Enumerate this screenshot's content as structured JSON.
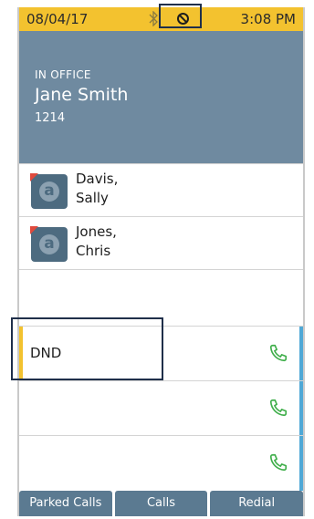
{
  "status_bar": {
    "date": "08/04/17",
    "time": "3:08 PM",
    "icons": [
      "bluetooth-icon",
      "do-not-disturb-icon"
    ],
    "background": "#f3c22f"
  },
  "header": {
    "presence": "IN OFFICE",
    "name": "Jane Smith",
    "extension": "1214",
    "background": "#6f8aa0"
  },
  "contacts": [
    {
      "name_line1": "Davis,",
      "name_line2": "Sally",
      "avatar_letter": "a"
    },
    {
      "name_line1": "Jones,",
      "name_line2": "Chris",
      "avatar_letter": "a"
    }
  ],
  "line_keys": [
    {
      "label": "DND",
      "icon": "phone-icon"
    },
    {
      "label": "",
      "icon": "phone-icon"
    },
    {
      "label": "",
      "icon": "phone-icon"
    }
  ],
  "softkeys": [
    {
      "label": "Parked Calls"
    },
    {
      "label": "Calls"
    },
    {
      "label": "Redial"
    }
  ],
  "colors": {
    "accent_yellow": "#f3c22f",
    "accent_blue": "#4fa8d6",
    "call_green": "#3fae4a",
    "softkey_bg": "#5b7a91"
  }
}
